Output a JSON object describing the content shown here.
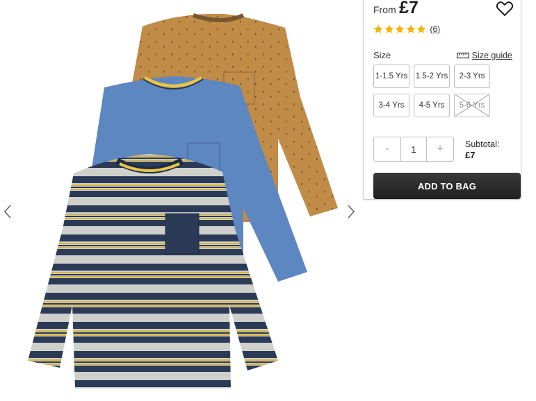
{
  "product": {
    "price_prefix": "From",
    "price": "£7",
    "rating_stars": 5,
    "review_count": "(6)"
  },
  "colors": {
    "star": "#f4b400",
    "button_bg": "#2a2a2a",
    "border": "#bdbdbd"
  },
  "size": {
    "label": "Size",
    "guide_label": "Size guide",
    "options": [
      {
        "label": "1-1.5 Yrs",
        "available": true
      },
      {
        "label": "1.5-2 Yrs",
        "available": true
      },
      {
        "label": "2-3 Yrs",
        "available": true
      },
      {
        "label": "3-4 Yrs",
        "available": true
      },
      {
        "label": "4-5 Yrs",
        "available": true
      },
      {
        "label": "5-6 Yrs",
        "available": false
      }
    ]
  },
  "quantity": {
    "decrement": "-",
    "value": "1",
    "increment": "+"
  },
  "subtotal": {
    "label": "Subtotal:",
    "value": "£7"
  },
  "cta": {
    "add_to_bag": "ADD TO BAG"
  },
  "icons": {
    "prev": "chevron-left-icon",
    "next": "chevron-right-icon",
    "wishlist": "heart-icon",
    "ruler": "ruler-icon",
    "star": "star-icon"
  }
}
